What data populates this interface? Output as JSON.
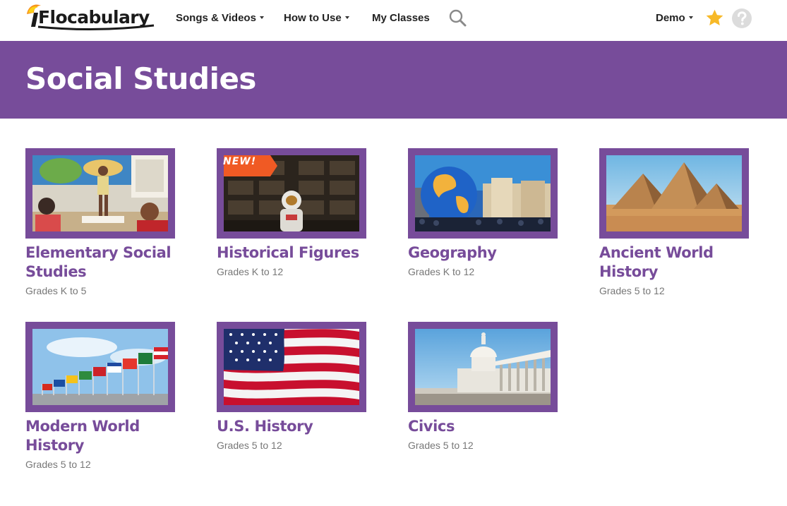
{
  "header": {
    "logo_text": "Flocabulary",
    "nav": [
      {
        "label": "Songs & Videos",
        "dropdown": true
      },
      {
        "label": "How to Use",
        "dropdown": true
      },
      {
        "label": "My Classes",
        "dropdown": false
      }
    ],
    "search_icon": "search-icon",
    "user_menu": "Demo",
    "favorites_icon": "star-icon",
    "help_icon": "help-icon"
  },
  "page": {
    "title": "Social Studies"
  },
  "cards": [
    {
      "title": "Elementary Social Studies",
      "grades": "Grades K to 5",
      "image": "classroom-image",
      "badge": ""
    },
    {
      "title": "Historical Figures",
      "grades": "Grades K to 12",
      "image": "astronaut-library-image",
      "badge": "NEW!"
    },
    {
      "title": "Geography",
      "grades": "Grades K to 12",
      "image": "globe-city-image",
      "badge": ""
    },
    {
      "title": "Ancient World History",
      "grades": "Grades 5 to 12",
      "image": "pyramids-image",
      "badge": ""
    },
    {
      "title": "Modern World History",
      "grades": "Grades 5 to 12",
      "image": "flags-image",
      "badge": ""
    },
    {
      "title": "U.S. History",
      "grades": "Grades 5 to 12",
      "image": "us-flag-image",
      "badge": ""
    },
    {
      "title": "Civics",
      "grades": "Grades 5 to 12",
      "image": "capitol-image",
      "badge": ""
    }
  ],
  "colors": {
    "brand_purple": "#774c9a",
    "badge_orange": "#f05a24",
    "star_yellow": "#f7b928"
  }
}
